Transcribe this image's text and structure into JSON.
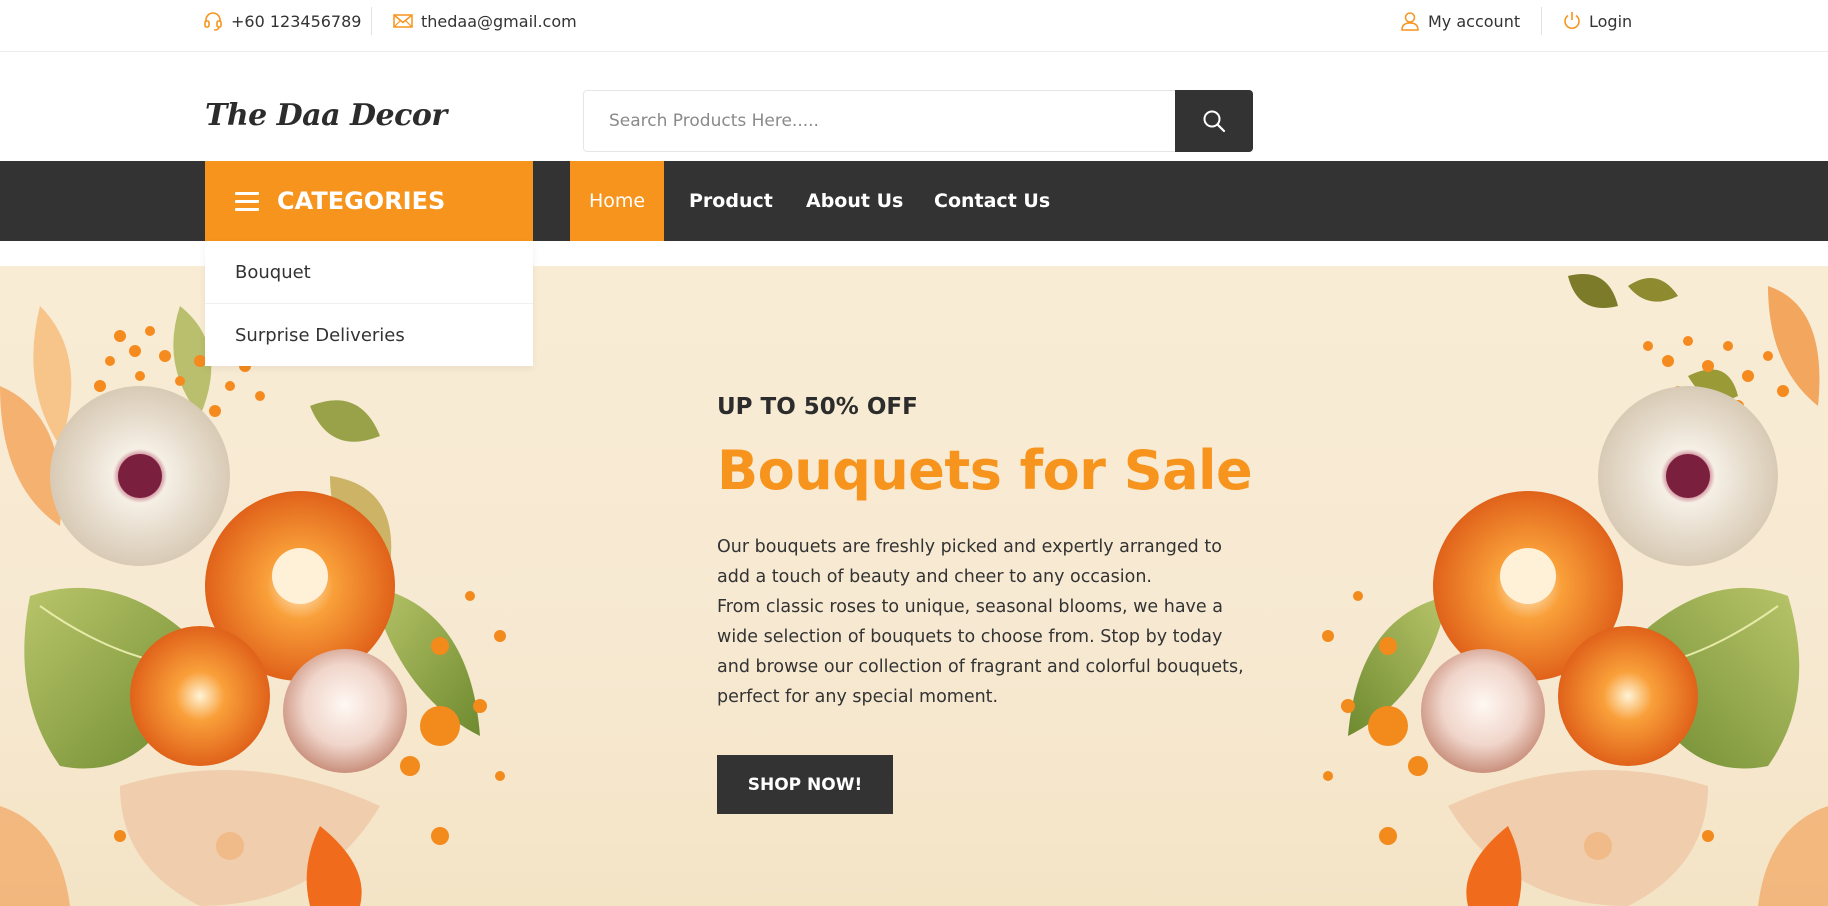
{
  "topbar": {
    "phone": "+60 123456789",
    "email": "thedaa@gmail.com",
    "account_label": "My account",
    "login_label": "Login",
    "icons": [
      "headset-icon",
      "mail-icon",
      "user-icon",
      "power-icon"
    ]
  },
  "header": {
    "logo_text": "The Daa Decor",
    "search_placeholder": "Search Products Here.....",
    "search_icon": "search-icon"
  },
  "nav": {
    "categories_label": "CATEGORIES",
    "items": [
      {
        "label": "Home",
        "active": true
      },
      {
        "label": "Product",
        "active": false
      },
      {
        "label": "About Us",
        "active": false
      },
      {
        "label": "Contact Us",
        "active": false
      }
    ]
  },
  "categories_dropdown": {
    "items": [
      "Bouquet",
      "Surprise Deliveries"
    ]
  },
  "hero": {
    "kicker": "UP TO 50% OFF",
    "headline": "Bouquets for Sale",
    "paragraph_1": "Our bouquets are freshly picked and expertly arranged to add a touch of beauty and cheer to any occasion.",
    "paragraph_2": "From classic roses to unique, seasonal blooms, we have a wide selection of bouquets to choose from. Stop by today and browse our collection of fragrant and colorful bouquets, perfect for any special moment.",
    "cta_label": "SHOP NOW!"
  },
  "colors": {
    "accent": "#f7941d",
    "dark": "#333333",
    "hero_bg": "#f8ebd3",
    "text": "#333333"
  }
}
